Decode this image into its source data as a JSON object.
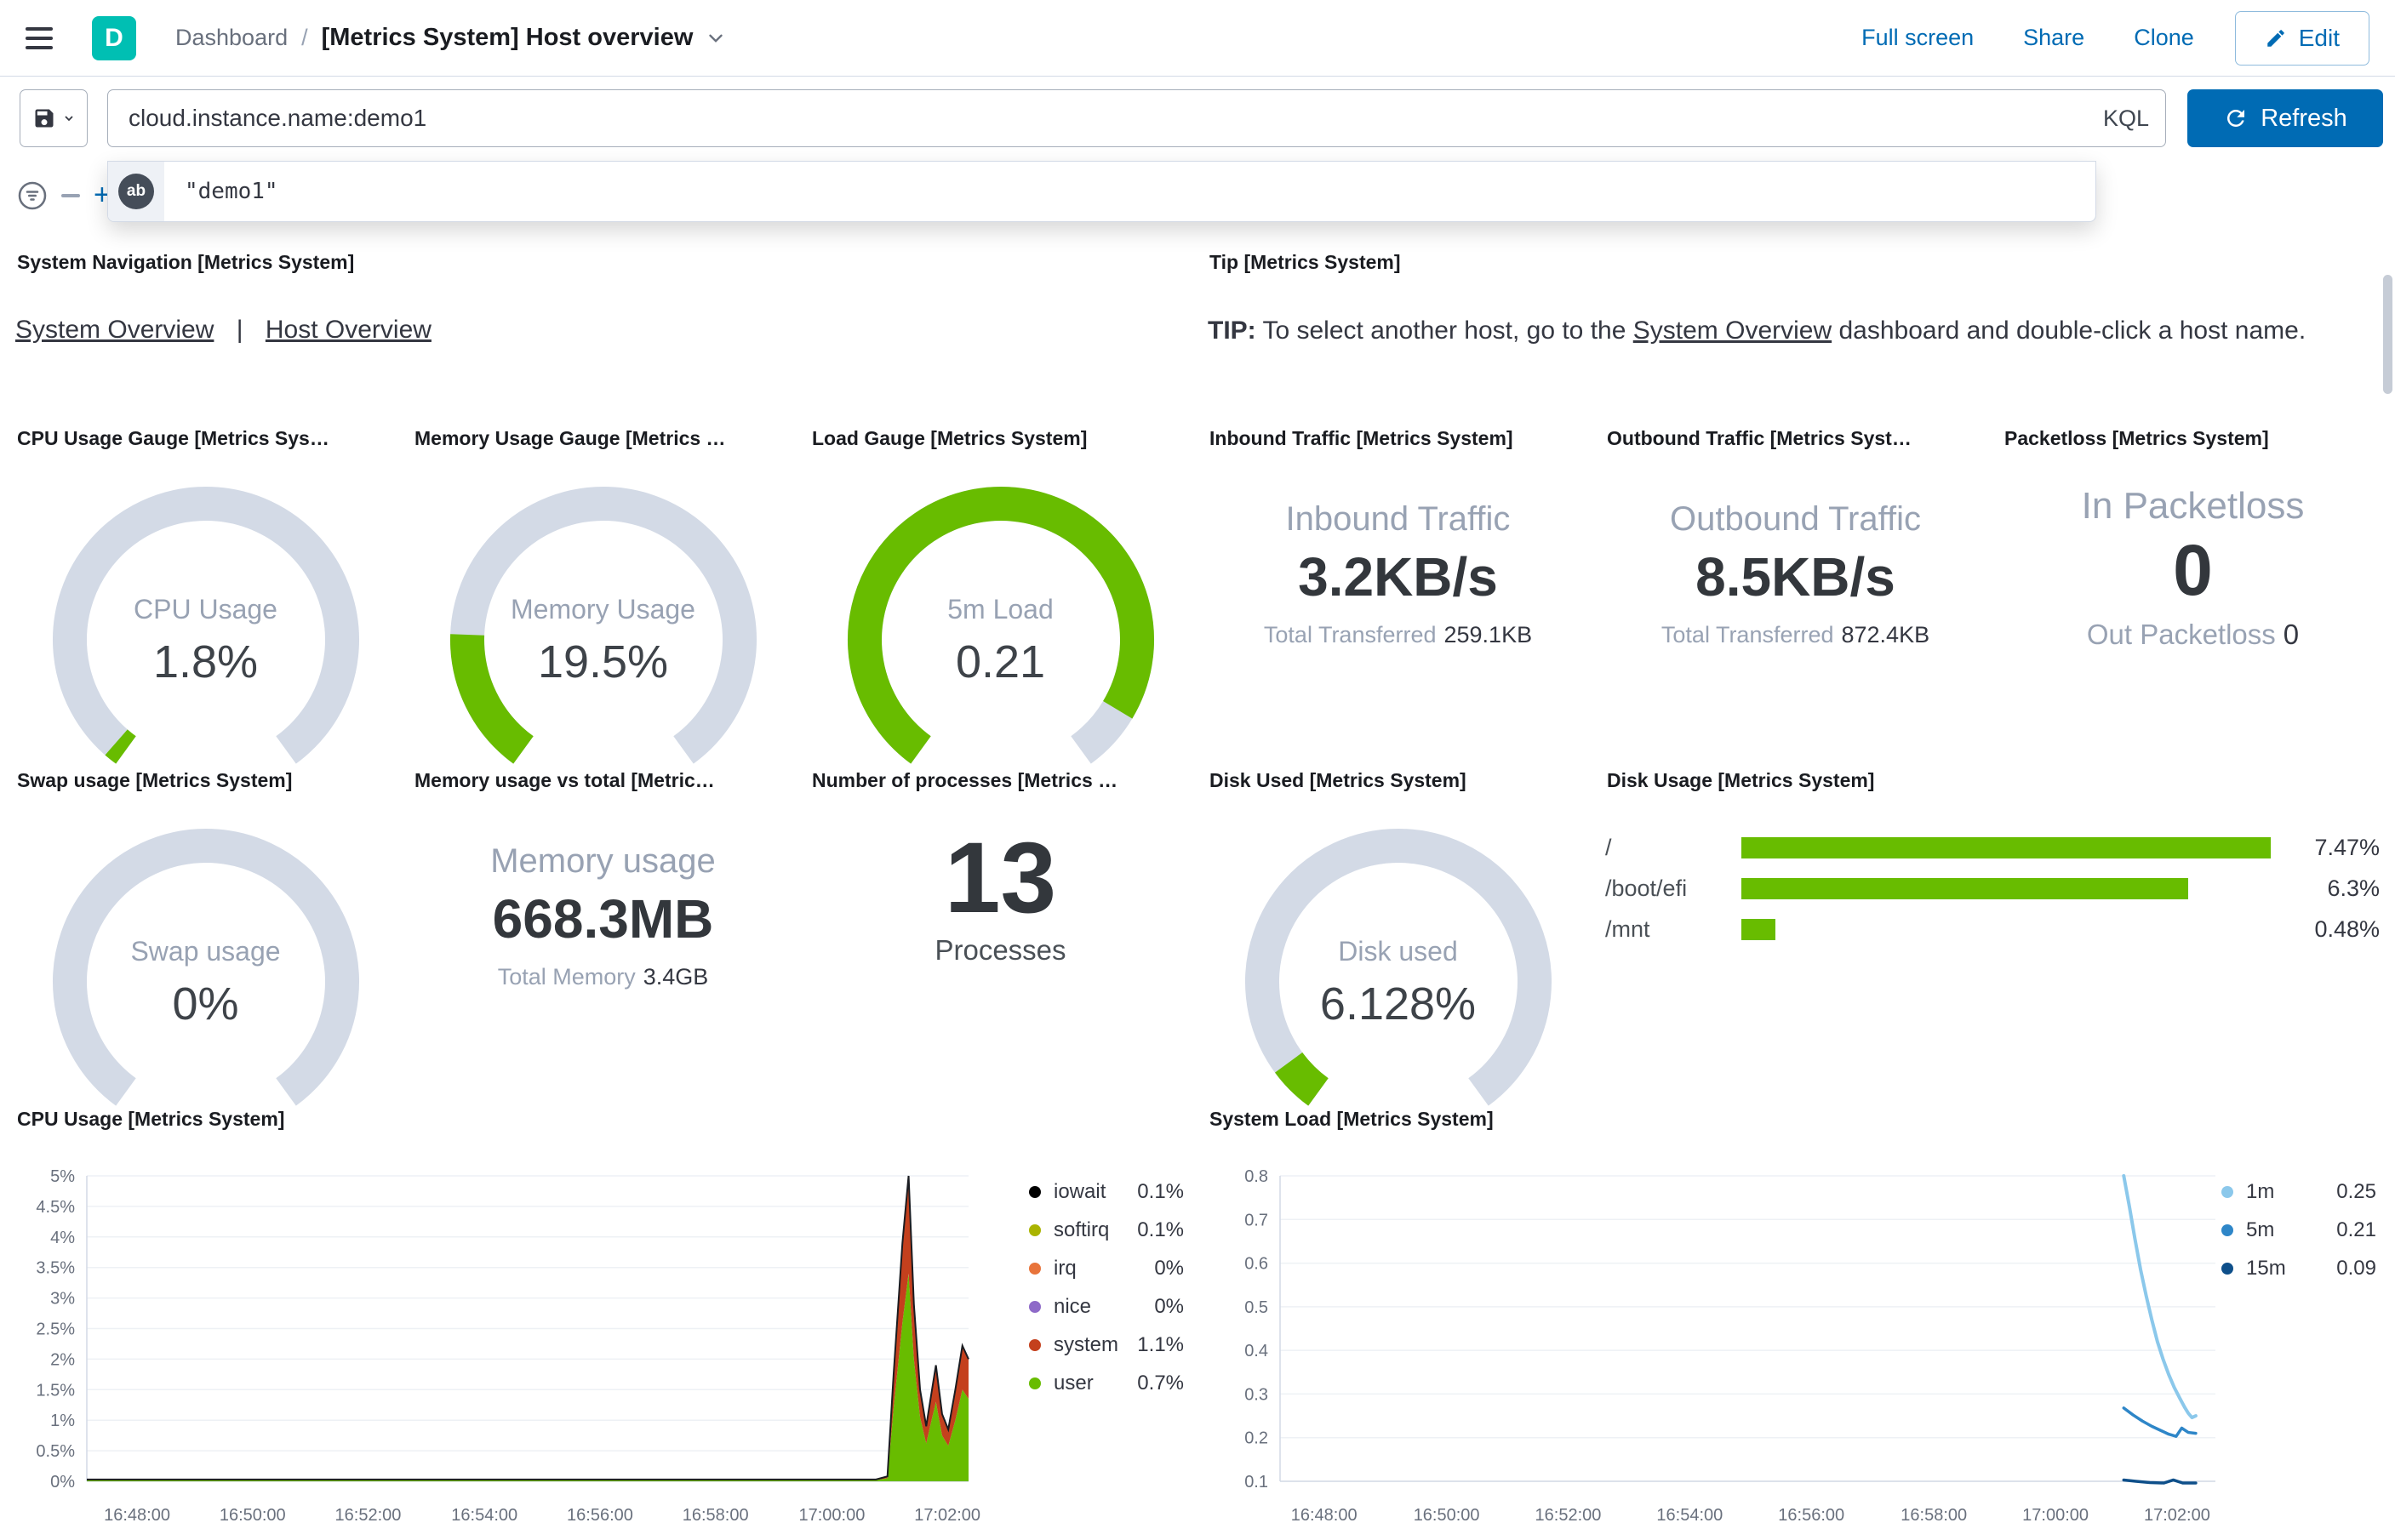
{
  "header": {
    "logo_letter": "D",
    "breadcrumb": {
      "root": "Dashboard",
      "separator": "/",
      "current": "[Metrics System] Host overview"
    },
    "actions": {
      "full_screen": "Full screen",
      "share": "Share",
      "clone": "Clone",
      "edit": "Edit"
    }
  },
  "query_bar": {
    "query": "cloud.instance.name:demo1",
    "language_label": "KQL",
    "refresh_label": "Refresh",
    "suggestion_value": "\"demo1\"",
    "add_filter_plus": "+"
  },
  "colors": {
    "green": "#68BC00",
    "gauge_track": "#D3DAE6",
    "accent_blue": "#006BB4",
    "teal": "#00BFB3"
  },
  "panels": {
    "system_navigation": {
      "title": "System Navigation [Metrics System]",
      "links": [
        "System Overview",
        "Host Overview"
      ],
      "separator": "|"
    },
    "tip": {
      "title": "Tip [Metrics System]",
      "label": "TIP:",
      "text_before": " To select another host, go to the ",
      "link_text": "System Overview",
      "text_after": " dashboard and double-click a host name."
    },
    "cpu_gauge": {
      "title": "CPU Usage Gauge [Metrics Sys…",
      "label": "CPU Usage",
      "value": "1.8%",
      "fraction": 0.018
    },
    "memory_gauge": {
      "title": "Memory Usage Gauge [Metrics …",
      "label": "Memory Usage",
      "value": "19.5%",
      "fraction": 0.195
    },
    "load_gauge": {
      "title": "Load Gauge [Metrics System]",
      "label": "5m Load",
      "value": "0.21",
      "fraction": 0.92
    },
    "inbound_traffic": {
      "title": "Inbound Traffic [Metrics System]",
      "label": "Inbound Traffic",
      "value": "3.2KB/s",
      "sub_label": "Total Transferred",
      "sub_value": "259.1KB"
    },
    "outbound_traffic": {
      "title": "Outbound Traffic [Metrics Syst…",
      "label": "Outbound Traffic",
      "value": "8.5KB/s",
      "sub_label": "Total Transferred",
      "sub_value": "872.4KB"
    },
    "packetloss": {
      "title": "Packetloss [Metrics System]",
      "label": "In Packetloss",
      "value": "0",
      "sub_label": "Out Packetloss",
      "sub_value": "0"
    },
    "swap_gauge": {
      "title": "Swap usage [Metrics System]",
      "label": "Swap usage",
      "value": "0%",
      "fraction": 0
    },
    "memory_total": {
      "title": "Memory usage vs total [Metric…",
      "label": "Memory usage",
      "value": "668.3MB",
      "sub_label": "Total Memory",
      "sub_value": "3.4GB"
    },
    "processes": {
      "title": "Number of processes [Metrics …",
      "value": "13",
      "label": "Processes"
    },
    "disk_used_gauge": {
      "title": "Disk Used [Metrics System]",
      "label": "Disk used",
      "value": "6.128%",
      "fraction": 0.0613
    },
    "disk_usage": {
      "title": "Disk Usage [Metrics System]"
    },
    "cpu_usage_chart": {
      "title": "CPU Usage [Metrics System]"
    },
    "system_load_chart": {
      "title": "System Load [Metrics System]"
    }
  },
  "chart_data": [
    {
      "id": "disk_usage",
      "type": "bar",
      "orientation": "horizontal",
      "title": "Disk Usage [Metrics System]",
      "categories": [
        "/",
        "/boot/efi",
        "/mnt"
      ],
      "values": [
        7.47,
        6.3,
        0.48
      ],
      "value_labels": [
        "7.47%",
        "6.3%",
        "0.48%"
      ],
      "xlim": [
        0,
        7.47
      ],
      "bar_color": "#68BC00"
    },
    {
      "id": "cpu_usage",
      "type": "area",
      "stacked": true,
      "title": "CPU Usage [Metrics System]",
      "ylim": [
        0,
        5
      ],
      "y_tick_values": [
        0,
        0.5,
        1,
        1.5,
        2,
        2.5,
        3,
        3.5,
        4,
        4.5,
        5
      ],
      "y_tick_labels": [
        "0%",
        "0.5%",
        "1%",
        "1.5%",
        "2%",
        "2.5%",
        "3%",
        "3.5%",
        "4%",
        "4.5%",
        "5%"
      ],
      "x_tick_labels": [
        "16:48:00",
        "16:50:00",
        "16:52:00",
        "16:54:00",
        "16:56:00",
        "16:58:00",
        "17:00:00",
        "17:02:00"
      ],
      "x_tick_fractions": [
        0.057,
        0.188,
        0.319,
        0.451,
        0.582,
        0.713,
        0.845,
        0.976
      ],
      "legend_position": "right",
      "grid": true,
      "legend": [
        {
          "name": "iowait",
          "value": "0.1%",
          "color": "#000000"
        },
        {
          "name": "softirq",
          "value": "0.1%",
          "color": "#AAB400"
        },
        {
          "name": "irq",
          "value": "0%",
          "color": "#E8743B"
        },
        {
          "name": "nice",
          "value": "0%",
          "color": "#8E6AC8"
        },
        {
          "name": "system",
          "value": "1.1%",
          "color": "#C4401D"
        },
        {
          "name": "user",
          "value": "0.7%",
          "color": "#68BC00"
        }
      ],
      "series": [
        {
          "name": "user",
          "color": "#68BC00",
          "points": [
            [
              0,
              0.02
            ],
            [
              0.895,
              0.02
            ],
            [
              0.908,
              0.05
            ],
            [
              0.915,
              1.2
            ],
            [
              0.925,
              2.6
            ],
            [
              0.932,
              3.4
            ],
            [
              0.938,
              2.0
            ],
            [
              0.945,
              1.05
            ],
            [
              0.952,
              0.62
            ],
            [
              0.958,
              1.0
            ],
            [
              0.963,
              1.3
            ],
            [
              0.97,
              0.75
            ],
            [
              0.977,
              0.58
            ],
            [
              0.985,
              1.0
            ],
            [
              0.993,
              1.5
            ],
            [
              1,
              1.35
            ]
          ]
        },
        {
          "name": "system",
          "color": "#C4401D",
          "points": [
            [
              0,
              0.01
            ],
            [
              0.895,
              0.01
            ],
            [
              0.908,
              0.03
            ],
            [
              0.915,
              0.55
            ],
            [
              0.925,
              1.3
            ],
            [
              0.932,
              1.6
            ],
            [
              0.938,
              0.9
            ],
            [
              0.945,
              0.45
            ],
            [
              0.952,
              0.28
            ],
            [
              0.958,
              0.45
            ],
            [
              0.963,
              0.6
            ],
            [
              0.97,
              0.35
            ],
            [
              0.977,
              0.27
            ],
            [
              0.985,
              0.5
            ],
            [
              0.993,
              0.72
            ],
            [
              1,
              0.65
            ]
          ]
        }
      ]
    },
    {
      "id": "system_load",
      "type": "line",
      "title": "System Load [Metrics System]",
      "ylim": [
        0.1,
        0.8
      ],
      "y_tick_values": [
        0.1,
        0.2,
        0.3,
        0.4,
        0.5,
        0.6,
        0.7,
        0.8
      ],
      "y_tick_labels": [
        "0.1",
        "0.2",
        "0.3",
        "0.4",
        "0.5",
        "0.6",
        "0.7",
        "0.8"
      ],
      "x_tick_labels": [
        "16:48:00",
        "16:50:00",
        "16:52:00",
        "16:54:00",
        "16:56:00",
        "16:58:00",
        "17:00:00",
        "17:02:00"
      ],
      "x_tick_fractions": [
        0.047,
        0.178,
        0.308,
        0.438,
        0.568,
        0.699,
        0.829,
        0.959
      ],
      "legend_position": "right",
      "grid": true,
      "legend": [
        {
          "name": "1m",
          "value": "0.25",
          "color": "#8BC8EB"
        },
        {
          "name": "5m",
          "value": "0.21",
          "color": "#2E86C8"
        },
        {
          "name": "15m",
          "value": "0.09",
          "color": "#0E4F8A"
        }
      ],
      "series": [
        {
          "name": "1m",
          "color": "#8BC8EB",
          "width": 4,
          "points": [
            [
              0.902,
              0.8
            ],
            [
              0.908,
              0.73
            ],
            [
              0.914,
              0.655
            ],
            [
              0.92,
              0.585
            ],
            [
              0.926,
              0.525
            ],
            [
              0.932,
              0.47
            ],
            [
              0.938,
              0.42
            ],
            [
              0.944,
              0.38
            ],
            [
              0.95,
              0.345
            ],
            [
              0.956,
              0.315
            ],
            [
              0.962,
              0.29
            ],
            [
              0.967,
              0.27
            ],
            [
              0.971,
              0.256
            ],
            [
              0.975,
              0.246
            ],
            [
              0.979,
              0.25
            ]
          ]
        },
        {
          "name": "5m",
          "color": "#2E86C8",
          "width": 3.5,
          "points": [
            [
              0.902,
              0.268
            ],
            [
              0.912,
              0.252
            ],
            [
              0.922,
              0.238
            ],
            [
              0.932,
              0.226
            ],
            [
              0.942,
              0.216
            ],
            [
              0.95,
              0.208
            ],
            [
              0.958,
              0.203
            ],
            [
              0.964,
              0.222
            ],
            [
              0.971,
              0.212
            ],
            [
              0.979,
              0.21
            ]
          ]
        },
        {
          "name": "15m",
          "color": "#0E4F8A",
          "width": 3.5,
          "points": [
            [
              0.902,
              0.103
            ],
            [
              0.915,
              0.1
            ],
            [
              0.93,
              0.097
            ],
            [
              0.945,
              0.093
            ],
            [
              0.955,
              0.103
            ],
            [
              0.965,
              0.092
            ],
            [
              0.979,
              0.09
            ]
          ]
        }
      ]
    }
  ]
}
